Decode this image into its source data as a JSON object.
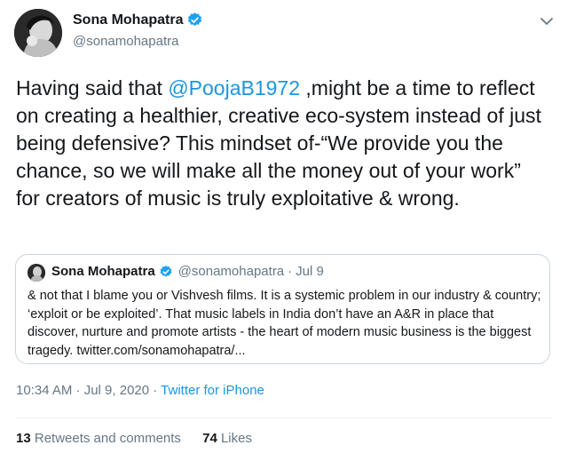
{
  "tweet": {
    "author": {
      "name": "Sona Mohapatra",
      "handle": "@sonamohapatra",
      "verified": true
    },
    "text_before": "Having said that ",
    "mention": "@PoojaB1972",
    "text_after": " ,might be a time to reflect on creating a healthier, creative eco-system instead of  just being defensive? This mindset of-“We provide you the chance, so we will make all the money out of your work” for creators of music is truly exploitative & wrong.",
    "time": "10:34 AM · Jul 9, 2020",
    "meta_sep": " · ",
    "source": "Twitter for iPhone"
  },
  "quote": {
    "author": {
      "name": "Sona Mohapatra",
      "handle": "@sonamohapatra",
      "verified": true
    },
    "dot": "·",
    "date": "Jul 9",
    "text": "& not that I blame you or Vishvesh films. It is a systemic problem in our industry & country; ‘exploit or be exploited’.   That music labels in India don’t have an A&R in place that discover, nurture and promote artists - the heart of modern music business is the biggest tragedy. twitter.com/sonamohapatra/..."
  },
  "stats": {
    "retweets_count": "13",
    "retweets_label": " Retweets and comments",
    "likes_count": "74",
    "likes_label": " Likes"
  },
  "colors": {
    "link": "#1b95e0",
    "verified": "#1da1f2",
    "secondary": "#657786",
    "border": "#ccd6dd"
  },
  "icons": {
    "verified": "verified-badge-icon",
    "caret": "chevron-down-icon"
  }
}
